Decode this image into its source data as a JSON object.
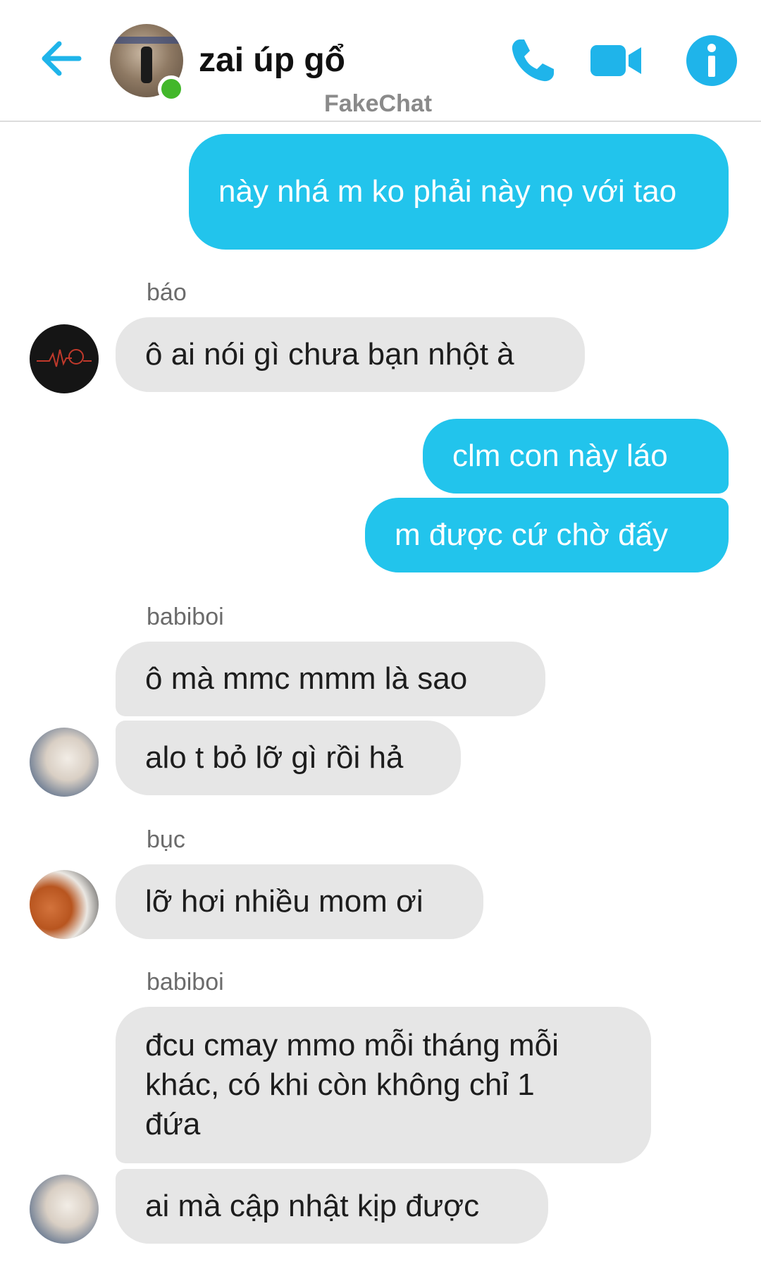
{
  "header": {
    "title": "zai úp gổ",
    "watermark": "FakeChat",
    "accent_color": "#1fb4ea",
    "icons": [
      "back-arrow-icon",
      "phone-icon",
      "video-camera-icon",
      "info-icon"
    ]
  },
  "messages": {
    "m1": "này nhá m ko phải này nọ với tao",
    "s1": "báo",
    "m2": "ô ai nói gì chưa bạn nhột à",
    "m3": "clm con này láo",
    "m4": "m được cứ chờ đấy",
    "s2": "babiboi",
    "m5": "ô mà mmc mmm là sao",
    "m6": "alo t bỏ lỡ gì rồi hả",
    "s3": "bục",
    "m7": "lỡ hơi nhiều mom ơi",
    "s4": "babiboi",
    "m8": "đcu cmay mmo mỗi tháng mỗi khác, có khi còn không chỉ 1 đứa",
    "m9": "ai mà cập nhật kịp được"
  },
  "colors": {
    "outgoing_bubble": "#22c4ec",
    "incoming_bubble": "#e6e6e6",
    "online_dot": "#42b72a"
  }
}
